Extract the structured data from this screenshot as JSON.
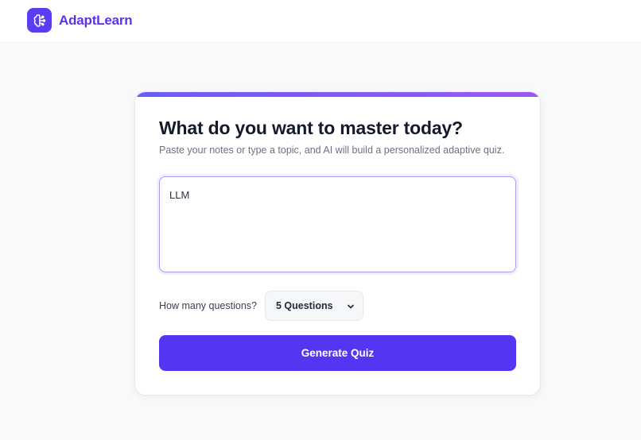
{
  "header": {
    "brand": "AdaptLearn",
    "logo_icon": "brain-icon",
    "logo_color": "#5a3cf2",
    "brand_color": "#5b34e8"
  },
  "card": {
    "title": "What do you want to master today?",
    "subtitle": "Paste your notes or type a topic, and AI will build a personalized adaptive quiz.",
    "topic_value": "LLM",
    "question_count_label": "How many questions?",
    "question_count_selected": "5 Questions",
    "generate_label": "Generate Quiz",
    "accent_gradient": [
      "#6a5cf6",
      "#9a58ee"
    ],
    "button_color": "#5436f2"
  }
}
